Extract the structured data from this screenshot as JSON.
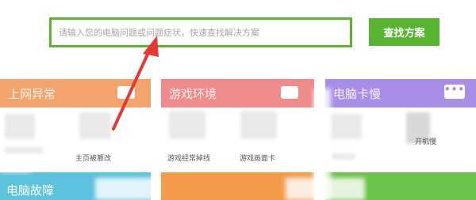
{
  "search": {
    "placeholder": "请输入您的电脑问题或问题症状，快速查找解决方案",
    "button_label": "查找方案"
  },
  "tiles": [
    {
      "title": "上网异常",
      "color": "#f3a46c",
      "items": [
        "主页被篡改"
      ]
    },
    {
      "title": "游戏环境",
      "color": "#f08b8b",
      "items": [
        "游戏经常掉线",
        "游戏画面卡"
      ]
    },
    {
      "title": "电脑卡慢",
      "color": "#a98ee8",
      "more_label": "•••",
      "items": [
        "开机慢"
      ]
    }
  ],
  "bottom_tiles": [
    {
      "title": "电脑故障",
      "color": "#5bc3dd"
    },
    {
      "title": "",
      "color": "#f49b4b"
    },
    {
      "title": "",
      "color": "#6cc24a"
    }
  ],
  "annotation": {
    "arrow_color": "#e53935"
  }
}
